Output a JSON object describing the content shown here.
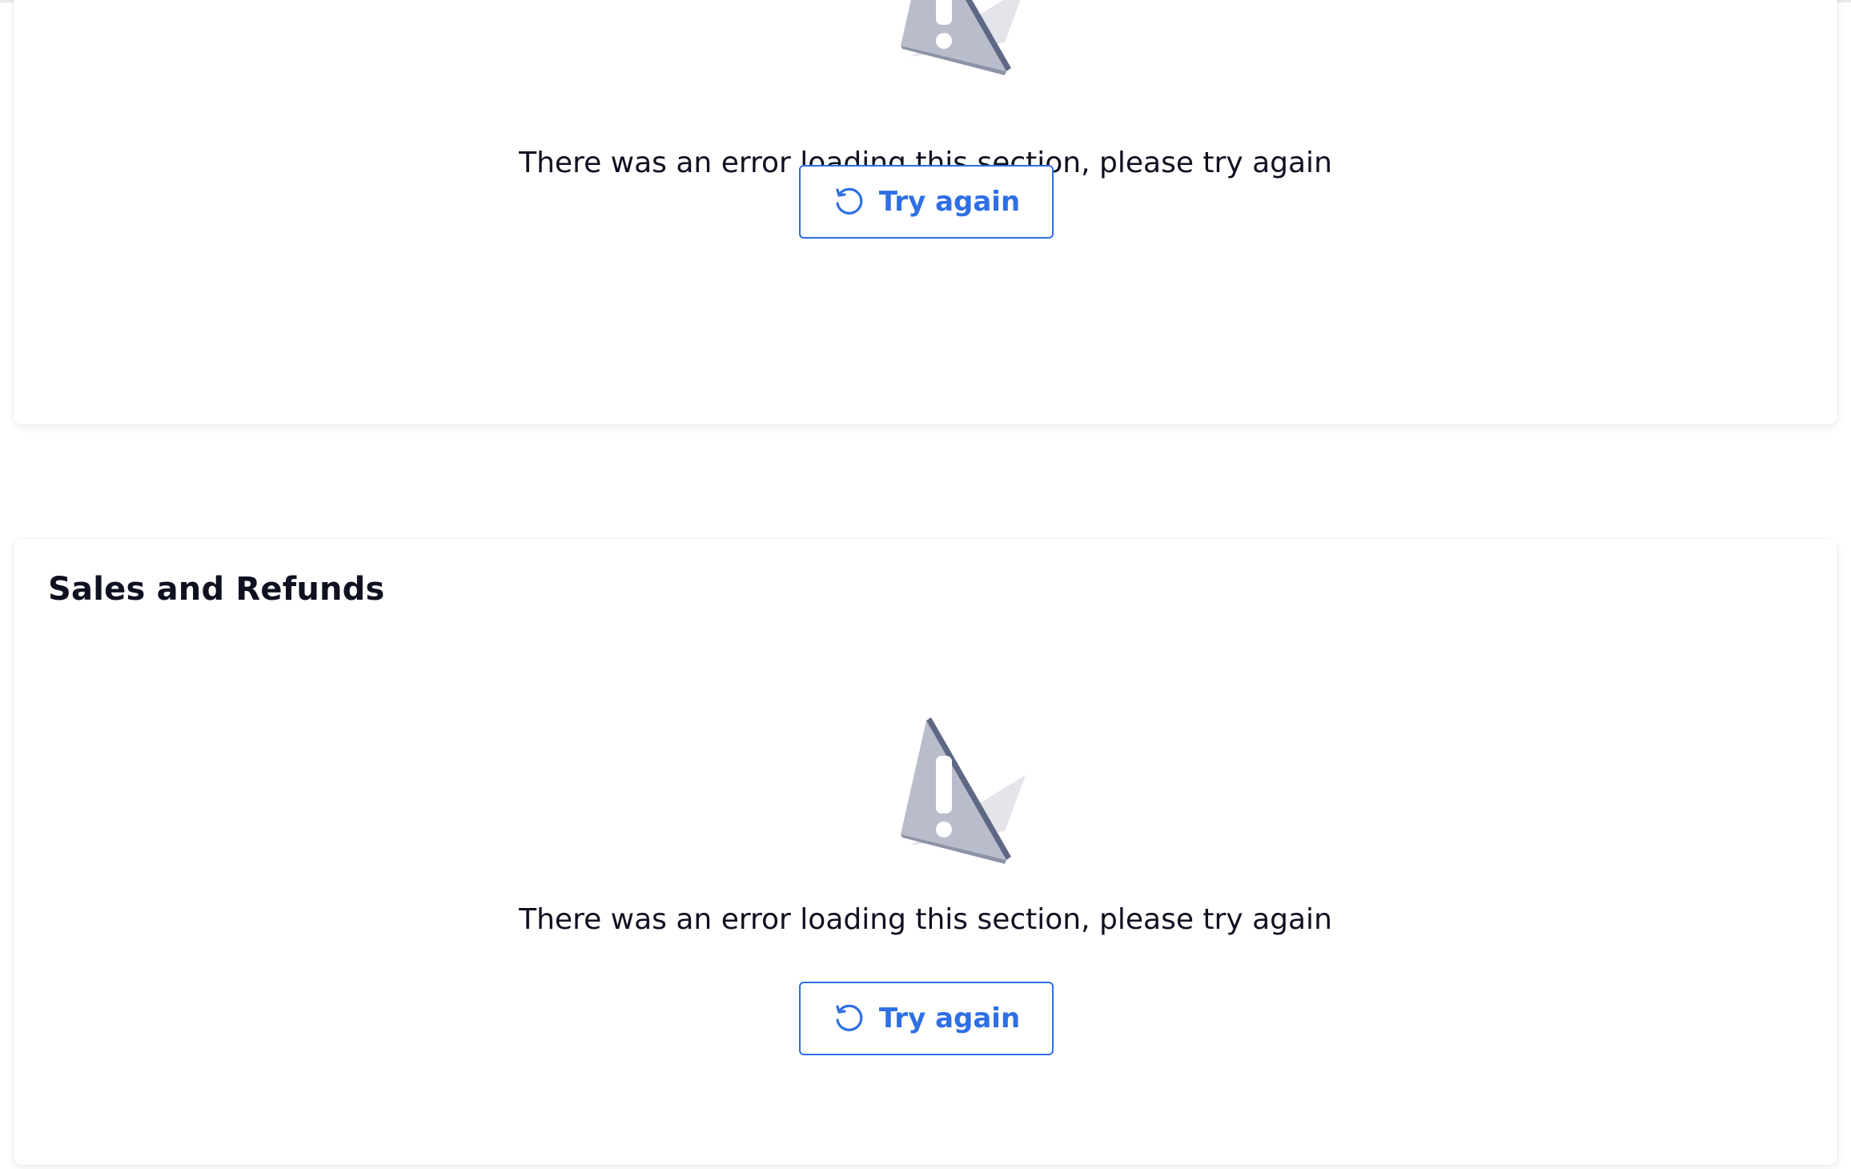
{
  "sections": [
    {
      "title": "",
      "icon": "warning-triangle-icon",
      "message": "There was an error loading this section, please try again",
      "retry_label": "Try again",
      "retry_icon": "refresh-icon"
    },
    {
      "title": "Sales and Refunds",
      "icon": "warning-triangle-icon",
      "message": "There was an error loading this section, please try again",
      "retry_label": "Try again",
      "retry_icon": "refresh-icon"
    }
  ],
  "colors": {
    "accent": "#2f6fe4",
    "text": "#0f1020",
    "warning_fill": "#b9bdcb",
    "warning_edge": "#5e6885",
    "warning_shadow": "#e4e5ea"
  }
}
